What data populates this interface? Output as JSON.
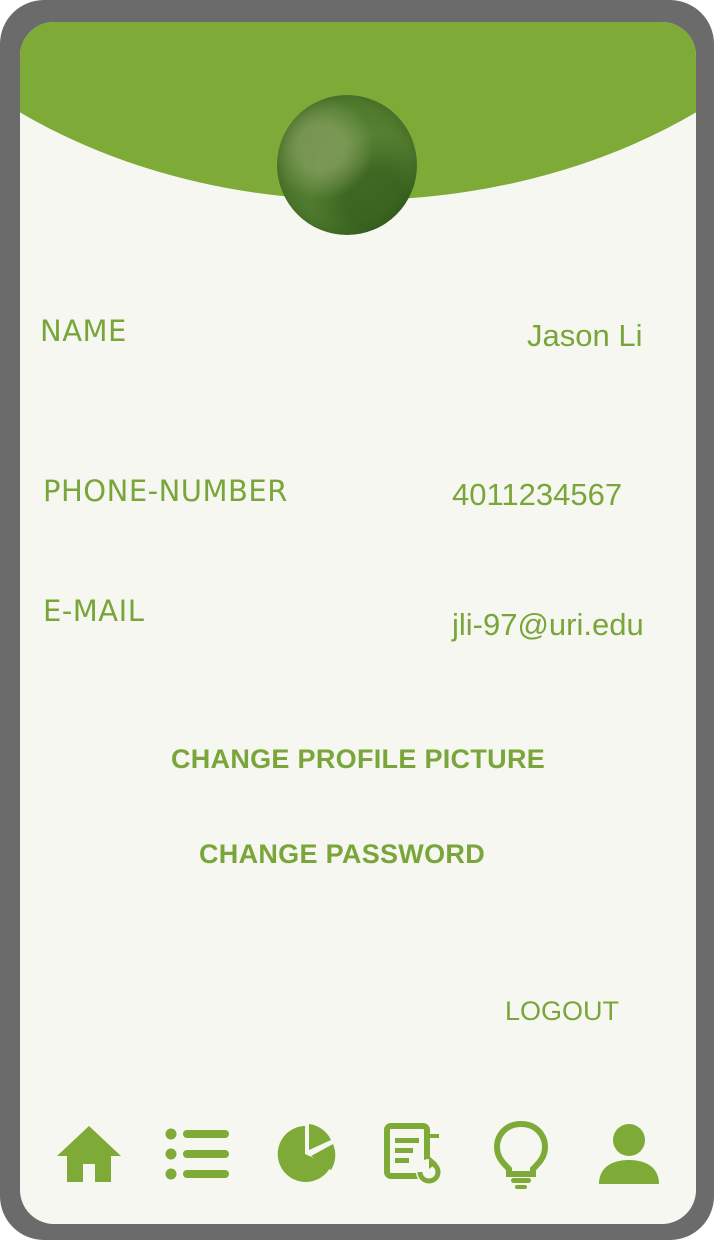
{
  "profile": {
    "fields": [
      {
        "label": "NAME",
        "value": "Jason Li"
      },
      {
        "label": "PHONE-NUMBER",
        "value": "4011234567"
      },
      {
        "label": "E-MAIL",
        "value": "jli-97@uri.edu"
      }
    ]
  },
  "actions": {
    "change_picture": "CHANGE PROFILE PICTURE",
    "change_password": "CHANGE PASSWORD",
    "logout": "LOGOUT"
  },
  "nav": {
    "items": [
      "home-icon",
      "list-icon",
      "pie-chart-icon",
      "report-icon",
      "lightbulb-icon",
      "person-icon"
    ],
    "active": "person-icon"
  },
  "colors": {
    "accent": "#7eaa38",
    "background": "#f6f7f1",
    "frame": "#6b6b6b"
  }
}
